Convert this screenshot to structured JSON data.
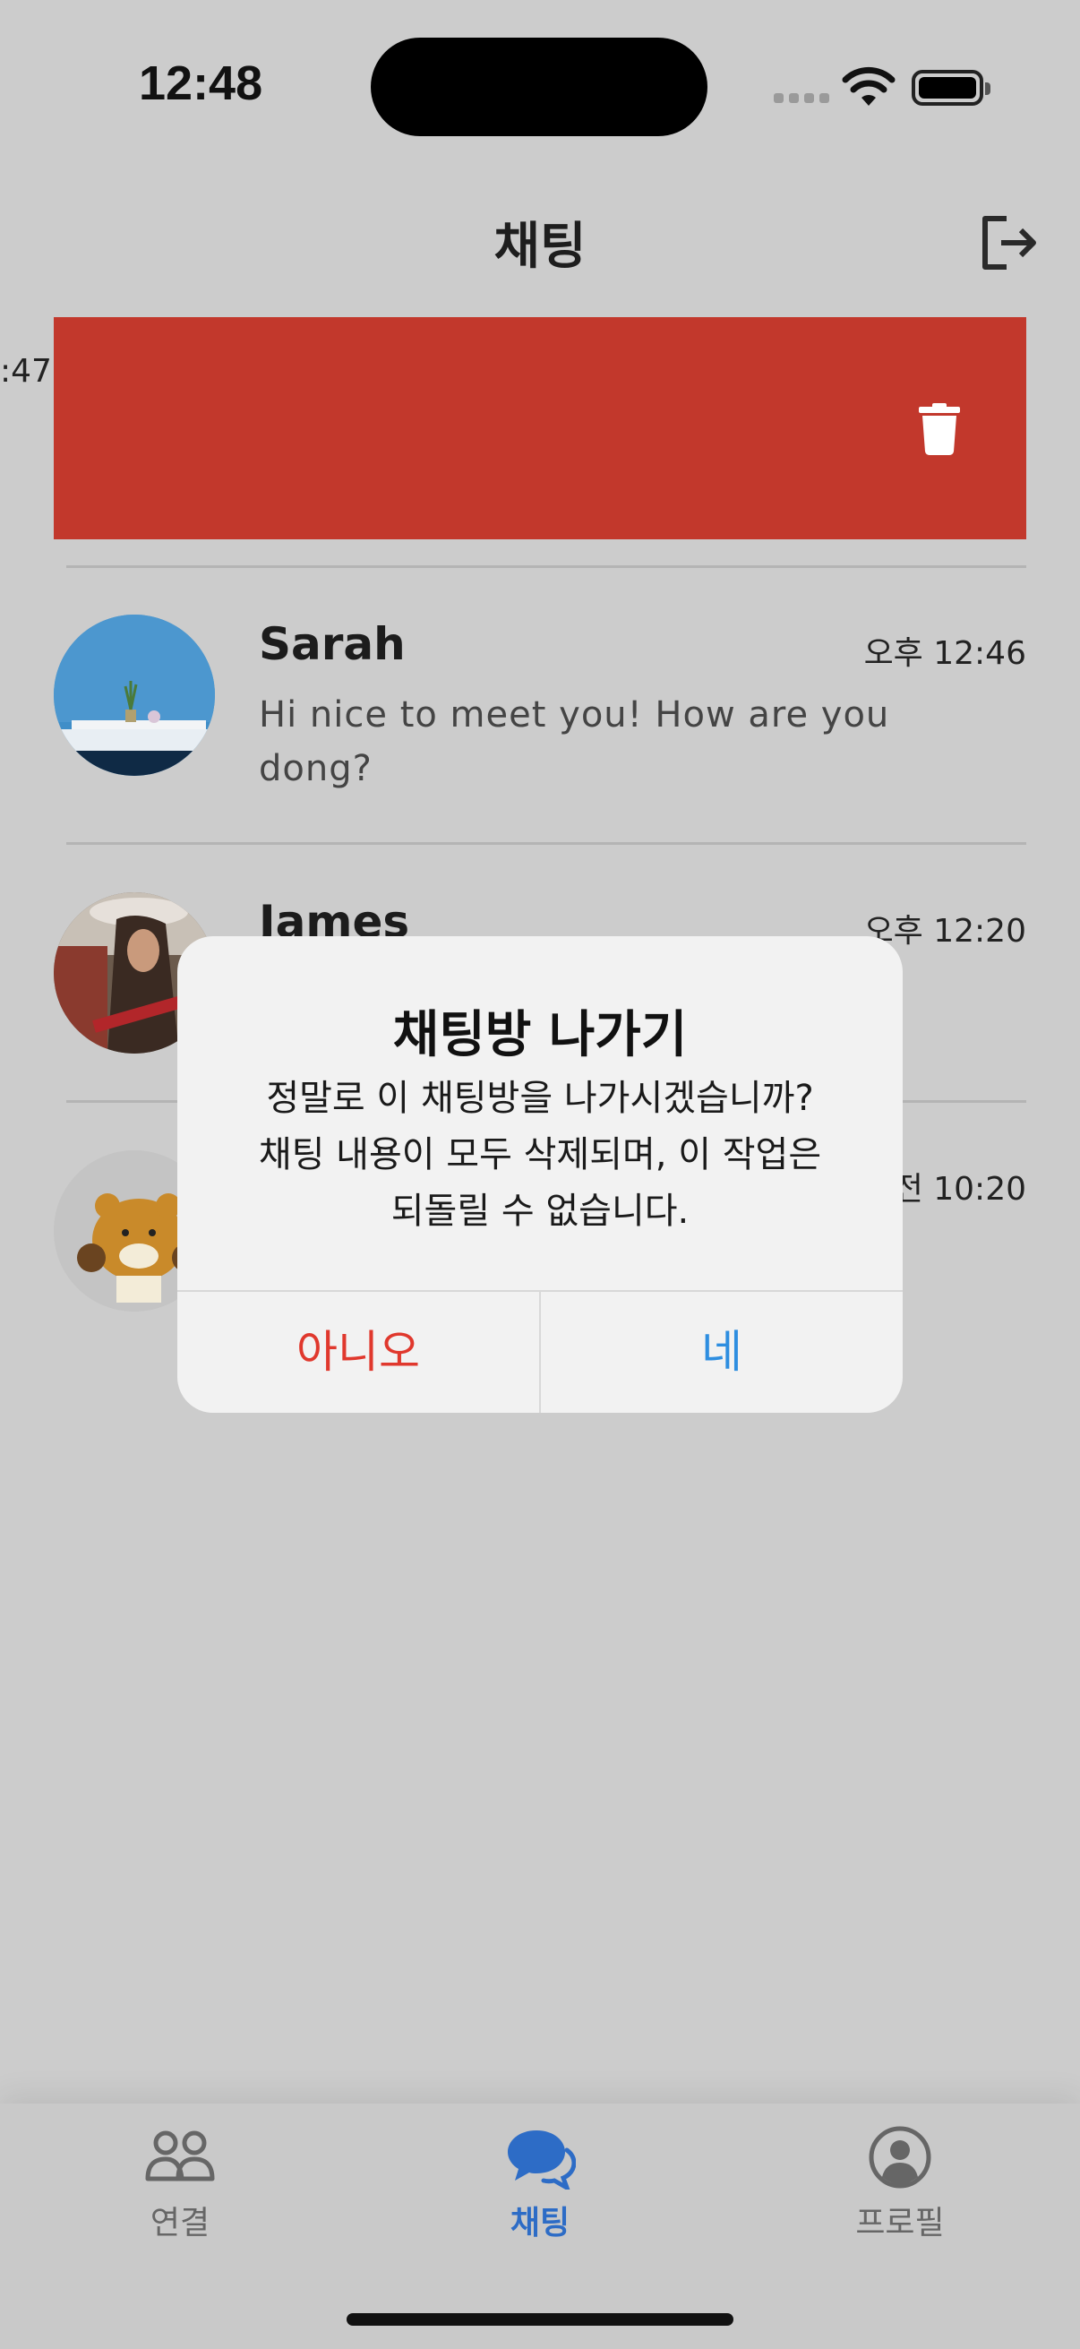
{
  "status_bar": {
    "time": "12:48"
  },
  "header": {
    "title": "채팅",
    "logout_icon": "logout-icon"
  },
  "swiped_row": {
    "time_fragment": ":47",
    "action_color": "#c2382c",
    "action_icon": "trash-icon"
  },
  "chats": [
    {
      "name": "Sarah",
      "time": "오후 12:46",
      "preview": "Hi nice to meet you! How are you dong?"
    },
    {
      "name": "James",
      "time": "오후 12:20",
      "preview": ""
    },
    {
      "name": "",
      "time": "전 10:20",
      "preview": ""
    }
  ],
  "dialog": {
    "title": "채팅방 나가기",
    "message_line1": "정말로 이 채팅방을 나가시겠습니까?",
    "message_line2": "채팅 내용이 모두 삭제되며, 이 작업은",
    "message_line3": "되돌릴 수 없습니다.",
    "no_label": "아니오",
    "yes_label": "네",
    "no_color": "#e0382d",
    "yes_color": "#2e8ee0"
  },
  "tabs": [
    {
      "label": "연결",
      "icon": "people-icon",
      "active": false
    },
    {
      "label": "채팅",
      "icon": "chat-bubbles-icon",
      "active": true
    },
    {
      "label": "프로필",
      "icon": "profile-icon",
      "active": false
    }
  ],
  "colors": {
    "accent": "#2d6cc6",
    "overlay_bg": "#cccccc"
  }
}
